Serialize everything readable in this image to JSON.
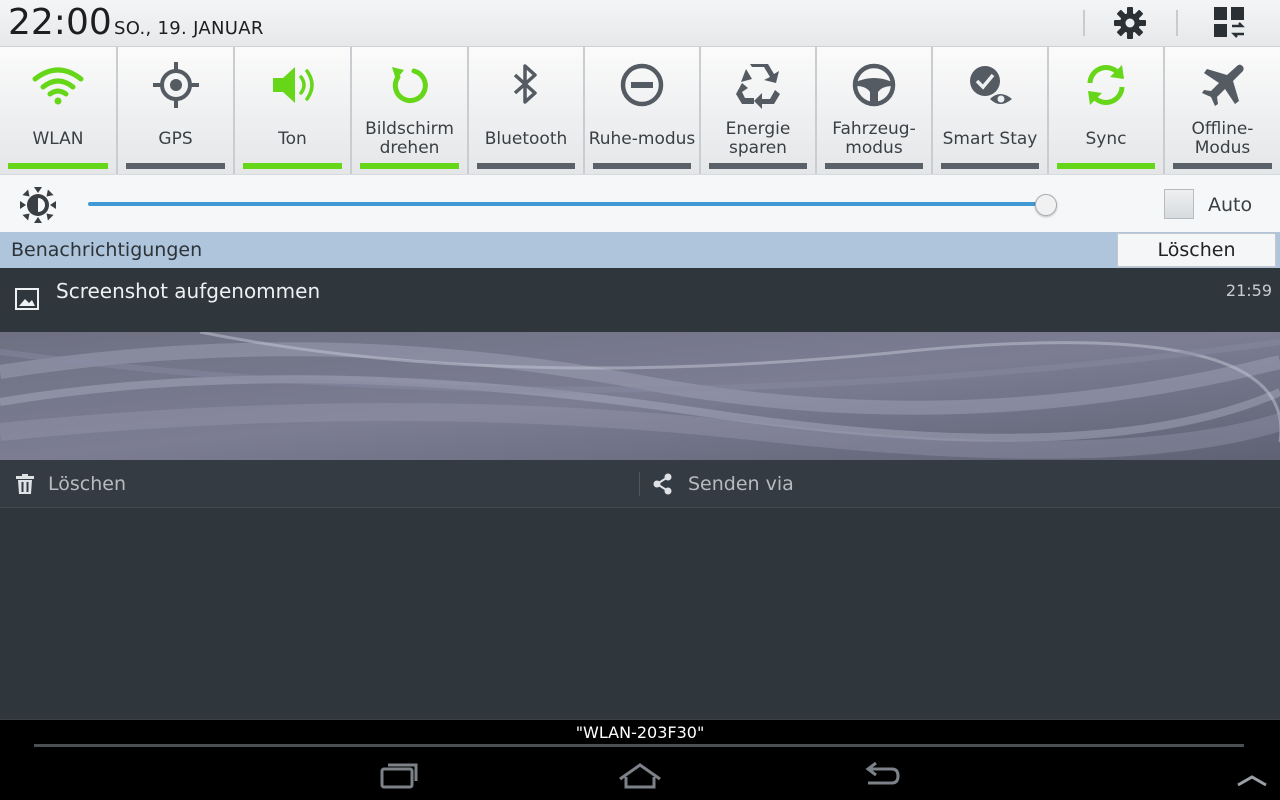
{
  "status": {
    "time": "22:00",
    "date": "SO., 19. JANUAR"
  },
  "header": {
    "settings_icon": "gear-icon",
    "multiwindow_icon": "multi-window-icon"
  },
  "quick_settings": [
    {
      "id": "wlan",
      "label": "WLAN",
      "on": true,
      "icon": "wifi-icon"
    },
    {
      "id": "gps",
      "label": "GPS",
      "on": false,
      "icon": "gps-icon"
    },
    {
      "id": "ton",
      "label": "Ton",
      "on": true,
      "icon": "speaker-icon"
    },
    {
      "id": "rotate",
      "label": "Bildschirm drehen",
      "on": true,
      "icon": "rotate-icon"
    },
    {
      "id": "bluetooth",
      "label": "Bluetooth",
      "on": false,
      "icon": "bluetooth-icon"
    },
    {
      "id": "ruhe",
      "label": "Ruhe-modus",
      "on": false,
      "icon": "do-not-disturb-icon"
    },
    {
      "id": "energie",
      "label": "Energie sparen",
      "on": false,
      "icon": "recycle-icon"
    },
    {
      "id": "fahrzeug",
      "label": "Fahrzeug-modus",
      "on": false,
      "icon": "steering-wheel-icon"
    },
    {
      "id": "smartstay",
      "label": "Smart Stay",
      "on": false,
      "icon": "smart-stay-icon"
    },
    {
      "id": "sync",
      "label": "Sync",
      "on": true,
      "icon": "sync-icon"
    },
    {
      "id": "offline",
      "label": "Offline-Modus",
      "on": false,
      "icon": "airplane-icon"
    }
  ],
  "brightness": {
    "level": 0.99,
    "auto_label": "Auto",
    "auto_checked": false
  },
  "notifications": {
    "header": "Benachrichtigungen",
    "clear_label": "Löschen",
    "items": [
      {
        "title": "Screenshot aufgenommen",
        "time": "21:59",
        "actions": [
          {
            "label": "Löschen",
            "icon": "trash-icon"
          },
          {
            "label": "Senden via",
            "icon": "share-icon"
          }
        ]
      }
    ]
  },
  "network": {
    "ssid": "\"WLAN-203F30\""
  },
  "nav": {
    "recent_icon": "recent-apps-icon",
    "home_icon": "home-icon",
    "back_icon": "back-icon",
    "expand_icon": "chevron-up-icon"
  },
  "colors": {
    "on": "#66d619",
    "off": "#5b6168",
    "accent": "#3f9ad6",
    "notif_header": "#aec5dc"
  }
}
